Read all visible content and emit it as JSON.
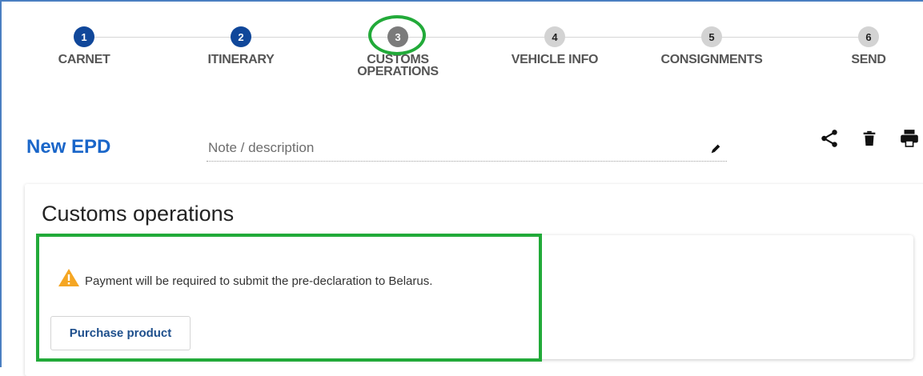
{
  "stepper": {
    "steps": [
      {
        "number": "1",
        "label": "CARNET",
        "state": "done"
      },
      {
        "number": "2",
        "label": "ITINERARY",
        "state": "done"
      },
      {
        "number": "3",
        "label": "CUSTOMS OPERATIONS",
        "state": "active"
      },
      {
        "number": "4",
        "label": "VEHICLE INFO",
        "state": "todo"
      },
      {
        "number": "5",
        "label": "CONSIGNMENTS",
        "state": "todo"
      },
      {
        "number": "6",
        "label": "SEND",
        "state": "todo"
      }
    ]
  },
  "header": {
    "title": "New EPD",
    "note_placeholder": "Note / description",
    "note_value": "",
    "actions": [
      "share-icon",
      "delete-icon",
      "print-icon"
    ]
  },
  "section": {
    "title": "Customs operations",
    "warning_icon": "warning-icon",
    "warning_text": "Payment will be required to submit the pre-declaration to Belarus.",
    "purchase_label": "Purchase product"
  },
  "colors": {
    "step_done": "#10479a",
    "step_active": "#7b7b7b",
    "step_todo": "#d3d3d3",
    "title_blue": "#1a66c9",
    "highlight_green": "#22aa39",
    "warning_orange": "#f5a623"
  }
}
